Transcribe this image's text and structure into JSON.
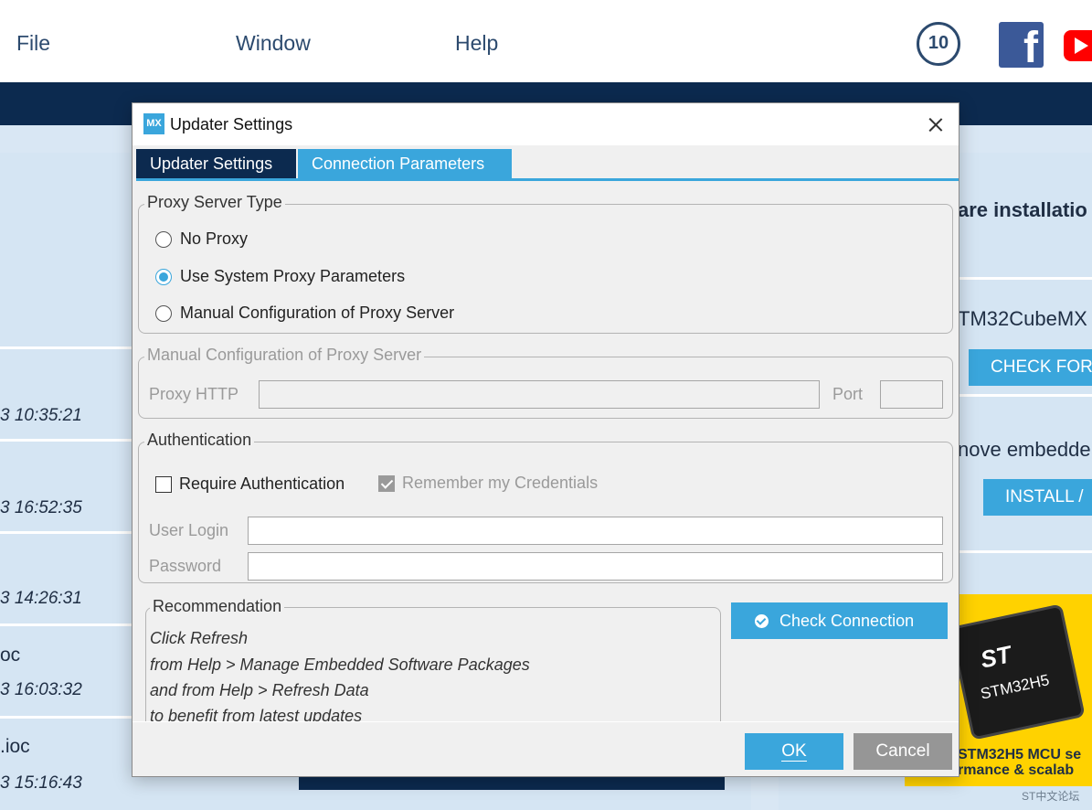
{
  "menubar": {
    "items": [
      "File",
      "Window",
      "Help"
    ],
    "badge_label": "10"
  },
  "recent_projects": [
    {
      "name": "",
      "date": "3 10:35:21"
    },
    {
      "name": "",
      "date": "3 16:52:35"
    },
    {
      "name": "",
      "date": "3 14:26:31"
    },
    {
      "name": "oc",
      "date": "3 16:03:32"
    },
    {
      "name": ".ioc",
      "date": "3 15:16:43"
    }
  ],
  "right_panel": {
    "install_heading": "are installatio",
    "cubemx_heading": "TM32CubeMX",
    "check_button": "CHECK FOR",
    "embedded_heading": "nove embedde",
    "install_button": "INSTALL /",
    "ad": {
      "logo": "ST",
      "chip_name": "STM32H5",
      "line1": "STM32H5 MCU se",
      "line2": "rmance & scalab"
    },
    "watermark": "ST中文论坛"
  },
  "dialog": {
    "title": "Updater Settings",
    "icon_text": "MX",
    "tabs": [
      "Updater Settings",
      "Connection Parameters"
    ],
    "active_tab": "Connection Parameters",
    "proxy_type": {
      "legend": "Proxy Server Type",
      "options": [
        "No Proxy",
        "Use System Proxy Parameters",
        "Manual Configuration of Proxy Server"
      ],
      "selected": "Use System Proxy Parameters"
    },
    "manual_config": {
      "legend": "Manual Configuration of Proxy Server",
      "proxy_label": "Proxy HTTP",
      "proxy_value": "",
      "port_label": "Port",
      "port_value": ""
    },
    "authentication": {
      "legend": "Authentication",
      "require_label": "Require Authentication",
      "require_checked": false,
      "remember_label": "Remember my Credentials",
      "remember_checked": true,
      "login_label": "User Login",
      "login_value": "",
      "password_label": "Password",
      "password_value": ""
    },
    "recommendation": {
      "legend": "Recommendation",
      "lines": [
        "Click Refresh",
        "from Help > Manage Embedded Software Packages",
        "and from Help > Refresh Data",
        "to benefit from latest updates"
      ]
    },
    "check_connection_label": "Check Connection",
    "ok_label": "OK",
    "cancel_label": "Cancel"
  },
  "colors": {
    "accent": "#3aa6dc",
    "navy": "#0c2a4f",
    "disabled_gray": "#969696"
  }
}
